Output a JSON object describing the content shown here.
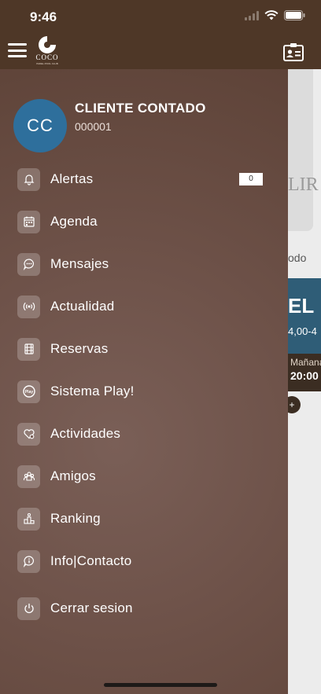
{
  "status_bar": {
    "time": "9:46"
  },
  "header": {
    "logo_text": "COCO",
    "logo_subtext": "PADEL POOL CLUB"
  },
  "user": {
    "initials": "CC",
    "name": "CLIENTE CONTADO",
    "id": "000001"
  },
  "menu": {
    "items": [
      {
        "label": "Alertas",
        "icon": "bell-icon",
        "badge": "0"
      },
      {
        "label": "Agenda",
        "icon": "calendar-icon"
      },
      {
        "label": "Mensajes",
        "icon": "chat-icon"
      },
      {
        "label": "Actualidad",
        "icon": "broadcast-icon"
      },
      {
        "label": "Reservas",
        "icon": "film-icon"
      },
      {
        "label": "Sistema Play!",
        "icon": "play-logo-icon"
      },
      {
        "label": "Actividades",
        "icon": "heart-icon"
      },
      {
        "label": "Amigos",
        "icon": "group-icon"
      },
      {
        "label": "Ranking",
        "icon": "podium-icon"
      },
      {
        "label": "Info|Contacto",
        "icon": "info-chat-icon"
      },
      {
        "label": "Cerrar sesion",
        "icon": "power-icon"
      }
    ]
  },
  "background": {
    "card1_text": "LIR",
    "period_text": "odo",
    "card2_title": "EL",
    "card2_time": "4,00-4",
    "card2_day": "Mañana",
    "card2_hour": "20:00"
  }
}
